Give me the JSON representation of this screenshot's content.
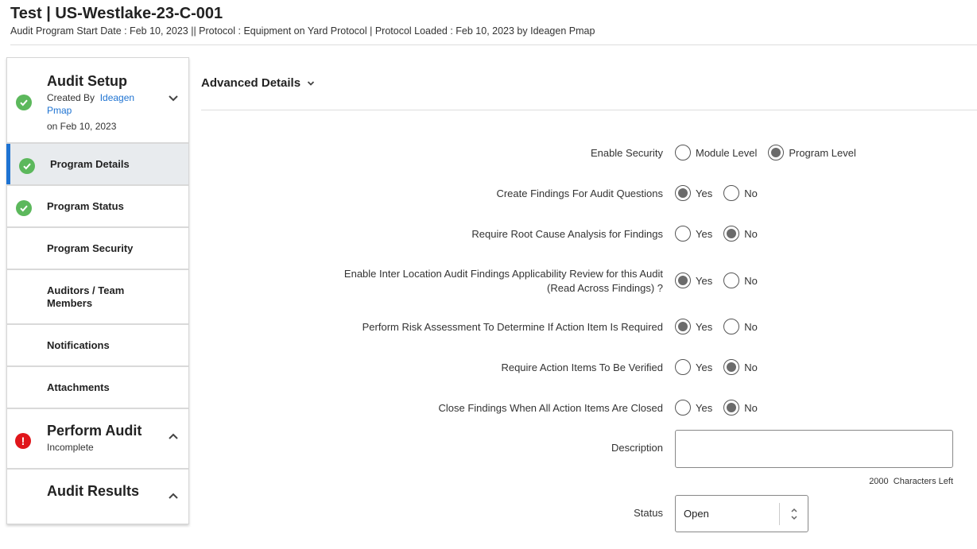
{
  "header": {
    "title": "Test | US-Westlake-23-C-001",
    "subtitle": "Audit Program Start Date : Feb 10, 2023 || Protocol : Equipment on Yard Protocol | Protocol Loaded : Feb 10, 2023 by Ideagen Pmap"
  },
  "sidebar": {
    "audit_setup": {
      "title": "Audit Setup",
      "created_by_label": "Created By",
      "created_by_user": "Ideagen Pmap",
      "created_on": "on Feb 10, 2023"
    },
    "items": [
      {
        "label": "Program Details"
      },
      {
        "label": "Program Status"
      },
      {
        "label": "Program Security"
      },
      {
        "label": "Auditors / Team Members"
      },
      {
        "label": "Notifications"
      },
      {
        "label": "Attachments"
      }
    ],
    "perform_audit": {
      "title": "Perform Audit",
      "status": "Incomplete"
    },
    "audit_results": {
      "title": "Audit Results"
    }
  },
  "main": {
    "heading": "Advanced Details",
    "fields": [
      {
        "label": "Enable Security",
        "options": [
          "Module Level",
          "Program Level"
        ],
        "selected": "Program Level"
      },
      {
        "label": "Create Findings For Audit Questions",
        "options": [
          "Yes",
          "No"
        ],
        "selected": "Yes"
      },
      {
        "label": "Require Root Cause Analysis for Findings",
        "options": [
          "Yes",
          "No"
        ],
        "selected": "No"
      },
      {
        "label_line1": "Enable Inter Location Audit Findings Applicability Review for this Audit",
        "label_line2": "(Read Across Findings) ?",
        "options": [
          "Yes",
          "No"
        ],
        "selected": "Yes"
      },
      {
        "label": "Perform Risk Assessment To Determine If Action Item Is Required",
        "options": [
          "Yes",
          "No"
        ],
        "selected": "Yes"
      },
      {
        "label": "Require Action Items To Be Verified",
        "options": [
          "Yes",
          "No"
        ],
        "selected": "No"
      },
      {
        "label": "Close Findings When All Action Items Are Closed",
        "options": [
          "Yes",
          "No"
        ],
        "selected": "No"
      }
    ],
    "description": {
      "label": "Description",
      "value": "",
      "chars_left_count": "2000",
      "chars_left_label": "Characters Left"
    },
    "status": {
      "label": "Status",
      "value": "Open"
    }
  },
  "colors": {
    "accent": "#1e73d2",
    "success": "#5cb85c",
    "error": "#e0161b"
  }
}
